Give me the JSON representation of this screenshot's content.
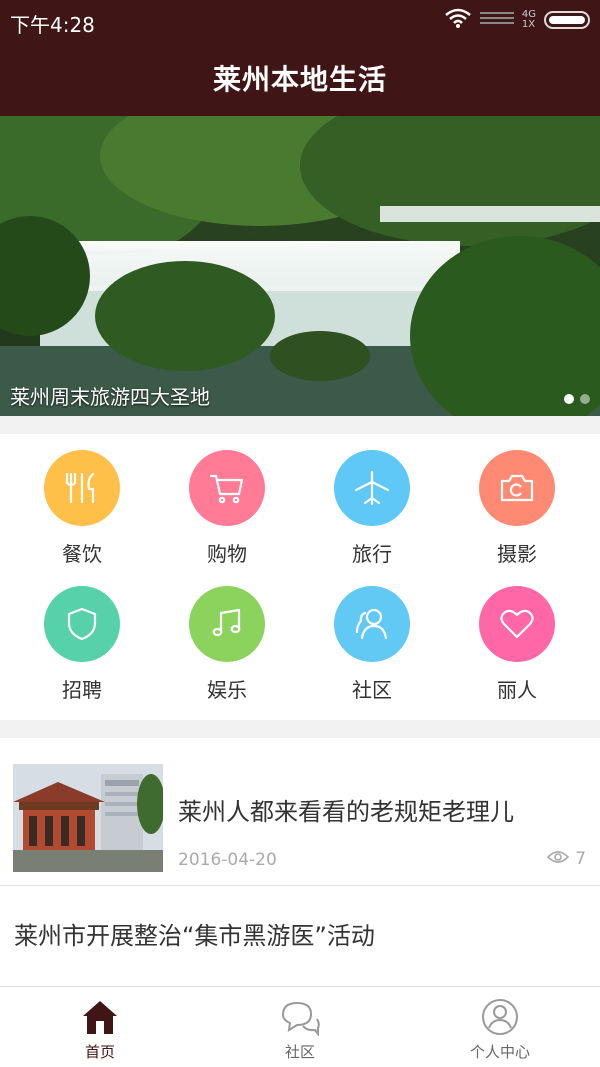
{
  "status": {
    "time": "下午4:28",
    "network_top": "4G",
    "network_bottom": "1X"
  },
  "header": {
    "title": "莱州本地生活"
  },
  "banner": {
    "caption": "莱州周末旅游四大圣地",
    "slide_count": 2,
    "active_slide": 1
  },
  "categories": [
    {
      "label": "餐饮",
      "icon": "utensils-icon",
      "color": "#ffc04a"
    },
    {
      "label": "购物",
      "icon": "cart-icon",
      "color": "#ff7b96"
    },
    {
      "label": "旅行",
      "icon": "airplane-icon",
      "color": "#5fc8f6"
    },
    {
      "label": "摄影",
      "icon": "camera-icon",
      "color": "#ff8a73"
    },
    {
      "label": "招聘",
      "icon": "shield-icon",
      "color": "#56d1a9"
    },
    {
      "label": "娱乐",
      "icon": "music-note-icon",
      "color": "#8cd35e"
    },
    {
      "label": "社区",
      "icon": "users-icon",
      "color": "#62c9f5"
    },
    {
      "label": "丽人",
      "icon": "heart-icon",
      "color": "#ff67a6"
    }
  ],
  "news": [
    {
      "title": "莱州人都来看看的老规矩老理儿",
      "date": "2016-04-20",
      "views": "7"
    },
    {
      "title": "莱州市开展整治“集市黑游医”活动"
    }
  ],
  "tabs": [
    {
      "label": "首页",
      "icon": "home-icon",
      "active": true
    },
    {
      "label": "社区",
      "icon": "chat-icon",
      "active": false
    },
    {
      "label": "个人中心",
      "icon": "user-icon",
      "active": false
    }
  ],
  "colors": {
    "brand": "#3f1515",
    "background": "#f2f2f2"
  }
}
